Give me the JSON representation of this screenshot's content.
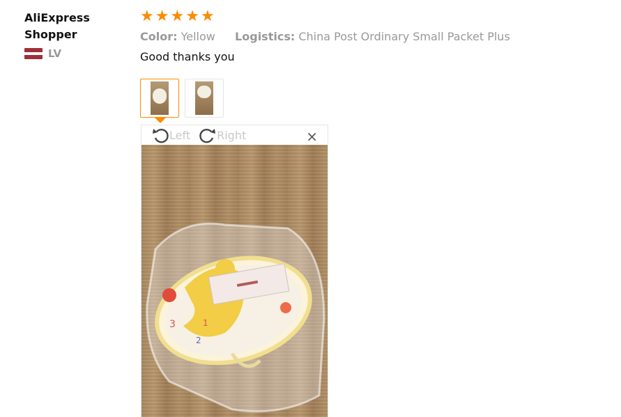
{
  "reviewer": {
    "name": "AliExpress Shopper",
    "country_code": "LV",
    "flag_colors": [
      "#9e3039",
      "#ffffff",
      "#9e3039"
    ]
  },
  "review": {
    "rating": 5,
    "stars": [
      "★",
      "★",
      "★",
      "★",
      "★"
    ],
    "color_label": "Color:",
    "color_value": "Yellow",
    "logistics_label": "Logistics:",
    "logistics_value": "China Post Ordinary Small Packet Plus",
    "text": "Good thanks you"
  },
  "thumbnails": [
    {
      "name": "review-photo-1",
      "active": true
    },
    {
      "name": "review-photo-2",
      "active": false
    }
  ],
  "viewer": {
    "rotate_left_label": "Left",
    "rotate_right_label": "Right",
    "close_icon": "×"
  },
  "colors": {
    "accent": "#ff8a00",
    "muted": "#999999"
  }
}
